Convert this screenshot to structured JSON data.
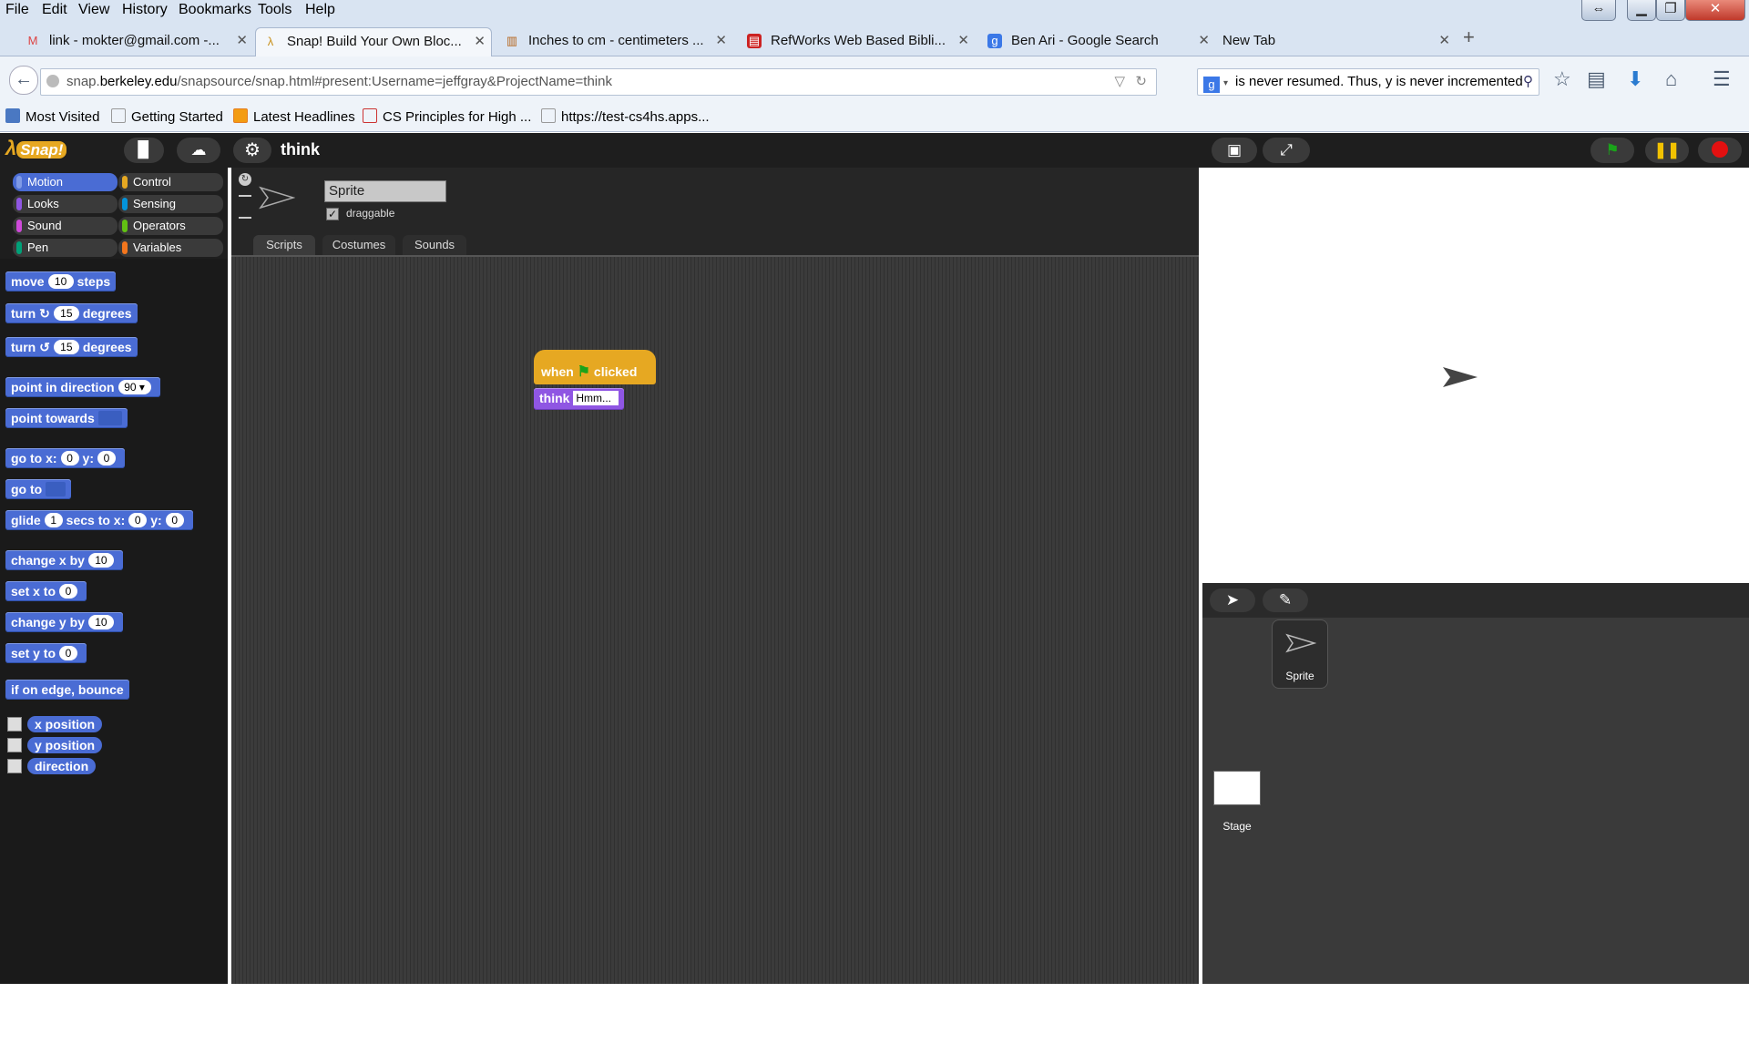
{
  "menubar": {
    "items": [
      "File",
      "Edit",
      "View",
      "History",
      "Bookmarks",
      "Tools",
      "Help"
    ]
  },
  "tabs": [
    {
      "title": "link - mokter@gmail.com -...",
      "icon": "gmail-icon",
      "active": false
    },
    {
      "title": "Snap! Build Your Own Bloc...",
      "icon": "snap-icon",
      "active": true
    },
    {
      "title": "Inches to cm - centimeters ...",
      "icon": "ruler-icon",
      "active": false
    },
    {
      "title": "RefWorks Web Based Bibli...",
      "icon": "refworks-icon",
      "active": false
    },
    {
      "title": "Ben Ari - Google Search",
      "icon": "google-icon",
      "active": false
    },
    {
      "title": "New Tab",
      "icon": "",
      "active": false
    }
  ],
  "address": {
    "url_prefix": "snap.",
    "url_domain": "berkeley.edu",
    "url_path": "/snapsource/snap.html#present:Username=jeffgray&ProjectName=think"
  },
  "search": {
    "value": "is never resumed. Thus, y is never incremented"
  },
  "bookmarks": [
    "Most Visited",
    "Getting Started",
    "Latest Headlines",
    "CS Principles for High ...",
    "https://test-cs4hs.apps..."
  ],
  "snap": {
    "logo": "Snap!",
    "project_name": "think",
    "categories": [
      {
        "label": "Motion",
        "color": "#4a6cd4"
      },
      {
        "label": "Control",
        "color": "#e6a822"
      },
      {
        "label": "Looks",
        "color": "#8f56e3"
      },
      {
        "label": "Sensing",
        "color": "#0494dc"
      },
      {
        "label": "Sound",
        "color": "#cf4ad9"
      },
      {
        "label": "Operators",
        "color": "#62c213"
      },
      {
        "label": "Pen",
        "color": "#00a178"
      },
      {
        "label": "Variables",
        "color": "#f3761d"
      }
    ],
    "blocks": {
      "move": {
        "pre": "move",
        "val": "10",
        "post": "steps"
      },
      "turn_cw": {
        "pre": "turn",
        "icon": "↻",
        "val": "15",
        "post": "degrees"
      },
      "turn_ccw": {
        "pre": "turn",
        "icon": "↺",
        "val": "15",
        "post": "degrees"
      },
      "point_dir": {
        "pre": "point in direction",
        "val": "90 ▾"
      },
      "point_towards": {
        "pre": "point towards"
      },
      "goto_xy": {
        "pre": "go to x:",
        "x": "0",
        "mid": "y:",
        "y": "0"
      },
      "goto": {
        "pre": "go to"
      },
      "glide": {
        "pre": "glide",
        "secs": "1",
        "mid1": "secs to x:",
        "x": "0",
        "mid2": "y:",
        "y": "0"
      },
      "change_x": {
        "pre": "change x by",
        "val": "10"
      },
      "set_x": {
        "pre": "set x to",
        "val": "0"
      },
      "change_y": {
        "pre": "change y by",
        "val": "10"
      },
      "set_y": {
        "pre": "set y to",
        "val": "0"
      },
      "bounce": {
        "label": "if on edge, bounce"
      },
      "x_position": "x position",
      "y_position": "y position",
      "direction": "direction"
    },
    "sprite": {
      "name": "Sprite",
      "draggable_label": "draggable"
    },
    "tabs": [
      "Scripts",
      "Costumes",
      "Sounds"
    ],
    "script": {
      "hat_when": "when",
      "hat_clicked": "clicked",
      "think_label": "think",
      "think_value": "Hmm..."
    },
    "corral": {
      "sprite_label": "Sprite",
      "stage_label": "Stage"
    }
  }
}
